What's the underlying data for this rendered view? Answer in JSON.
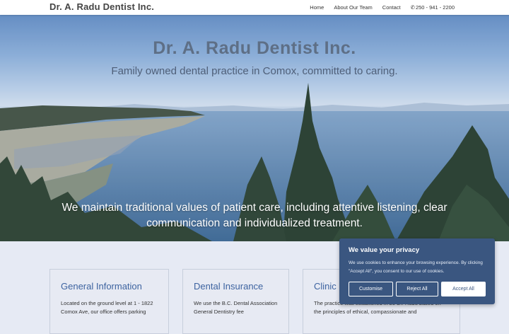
{
  "header": {
    "brand": "Dr. A. Radu Dentist Inc.",
    "nav": [
      "Home",
      "About Our Team",
      "Contact"
    ],
    "phone": "250 - 941 - 2200",
    "phone_icon": "phone-icon"
  },
  "hero": {
    "title": "Dr. A. Radu Dentist Inc.",
    "subtitle": "Family owned dental practice in Comox, committed to caring.",
    "values": "We maintain traditional values of patient care, including attentive listening, clear communication and individualized treatment."
  },
  "cards": [
    {
      "title": "General Information",
      "text": "Located on the ground level at 1 - 1822 Comox Ave, our office offers parking"
    },
    {
      "title": "Dental Insurance",
      "text": "We use the B.C. Dental Association General Dentistry fee"
    },
    {
      "title": "Clinic",
      "text": "The practice was established in 20 Dr. Radu based on the principles of ethical, compassionate and"
    }
  ],
  "cookie": {
    "title": "We value your privacy",
    "text": "We use cookies to enhance your browsing experience. By clicking \"Accept All\", you consent to our use of cookies.",
    "customise": "Customise",
    "reject": "Reject All",
    "accept": "Accept All"
  }
}
